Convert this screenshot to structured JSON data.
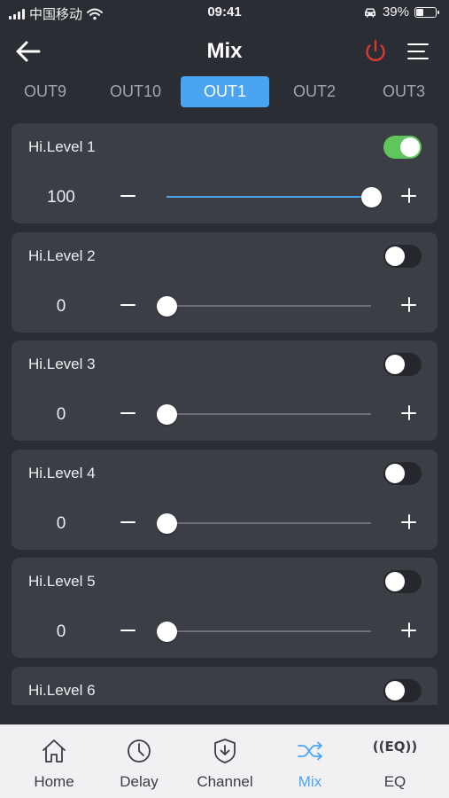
{
  "status": {
    "carrier": "中国移动",
    "time": "09:41",
    "battery_percent": "39%",
    "battery_level": 0.39,
    "icons": [
      "signal-icon",
      "wifi-icon",
      "car-icon",
      "battery-icon"
    ]
  },
  "header": {
    "title": "Mix",
    "back_icon": "arrow-left-icon",
    "power_icon": "power-icon",
    "menu_icon": "menu-icon",
    "power_color": "#e53b30"
  },
  "output_tabs": [
    {
      "label": "OUT9",
      "active": false
    },
    {
      "label": "OUT10",
      "active": false
    },
    {
      "label": "OUT1",
      "active": true
    },
    {
      "label": "OUT2",
      "active": false
    },
    {
      "label": "OUT3",
      "active": false
    }
  ],
  "channels": [
    {
      "label": "Hi.Level 1",
      "enabled": true,
      "value": "100",
      "level": 1.0
    },
    {
      "label": "Hi.Level 2",
      "enabled": false,
      "value": "0",
      "level": 0.0
    },
    {
      "label": "Hi.Level 3",
      "enabled": false,
      "value": "0",
      "level": 0.0
    },
    {
      "label": "Hi.Level 4",
      "enabled": false,
      "value": "0",
      "level": 0.0
    },
    {
      "label": "Hi.Level 5",
      "enabled": false,
      "value": "0",
      "level": 0.0
    },
    {
      "label": "Hi.Level 6",
      "enabled": false,
      "value": "",
      "level": 0.0
    }
  ],
  "bottom_tabs": [
    {
      "label": "Home",
      "icon": "home-icon",
      "active": false
    },
    {
      "label": "Delay",
      "icon": "clock-icon",
      "active": false
    },
    {
      "label": "Channel",
      "icon": "channel-shield-icon",
      "active": false
    },
    {
      "label": "Mix",
      "icon": "shuffle-icon",
      "active": true
    },
    {
      "label": "EQ",
      "icon": "eq-icon",
      "icon_text": "((EQ))",
      "active": false
    }
  ],
  "colors": {
    "background": "#2b2d34",
    "card": "#3c3e46",
    "accent": "#4ba4f2",
    "toggle_on": "#5fc65c",
    "tab_bar": "#f1f1f3"
  }
}
